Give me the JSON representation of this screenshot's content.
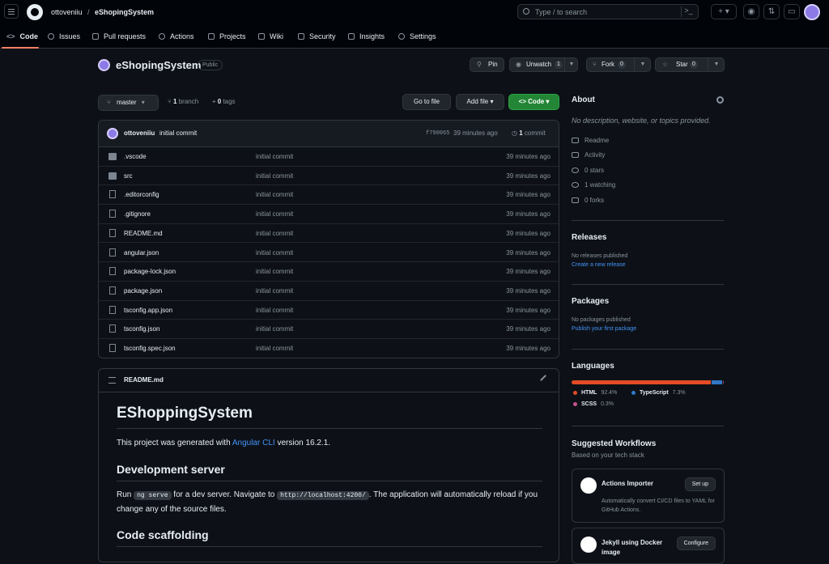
{
  "header": {
    "owner": "ottoveniiu",
    "separator": "/",
    "repo": "eShopingSystem",
    "search_placeholder": "Type / to search",
    "cmd_glyph": ">_"
  },
  "tabs": [
    "Code",
    "Issues",
    "Pull requests",
    "Actions",
    "Projects",
    "Wiki",
    "Security",
    "Insights",
    "Settings"
  ],
  "repo": {
    "name": "eShopingSystem",
    "visibility": "Public",
    "pin_label": "Pin",
    "watch_label": "Unwatch",
    "watch_count": "1",
    "fork_label": "Fork",
    "fork_count": "0",
    "star_label": "Star",
    "star_count": "0"
  },
  "branch_bar": {
    "branch": "master",
    "branches_count": "1",
    "branches_label": "branch",
    "tags_count": "0",
    "tags_label": "tags",
    "goto_file": "Go to file",
    "add_file": "Add file",
    "code_button": "Code"
  },
  "commit": {
    "user": "ottoveniiu",
    "message": "initial commit",
    "hash": "f790065",
    "time": "39 minutes ago",
    "count": "1",
    "count_label": "commit"
  },
  "files": [
    {
      "name": ".vscode",
      "type": "folder",
      "message": "initial commit",
      "time": "39 minutes ago"
    },
    {
      "name": "src",
      "type": "folder",
      "message": "initial commit",
      "time": "39 minutes ago"
    },
    {
      "name": ".editorconfig",
      "type": "file",
      "message": "initial commit",
      "time": "39 minutes ago"
    },
    {
      "name": ".gitignore",
      "type": "file",
      "message": "initial commit",
      "time": "39 minutes ago"
    },
    {
      "name": "README.md",
      "type": "file",
      "message": "initial commit",
      "time": "39 minutes ago"
    },
    {
      "name": "angular.json",
      "type": "file",
      "message": "initial commit",
      "time": "39 minutes ago"
    },
    {
      "name": "package-lock.json",
      "type": "file",
      "message": "initial commit",
      "time": "39 minutes ago"
    },
    {
      "name": "package.json",
      "type": "file",
      "message": "initial commit",
      "time": "39 minutes ago"
    },
    {
      "name": "tsconfig.app.json",
      "type": "file",
      "message": "initial commit",
      "time": "39 minutes ago"
    },
    {
      "name": "tsconfig.json",
      "type": "file",
      "message": "initial commit",
      "time": "39 minutes ago"
    },
    {
      "name": "tsconfig.spec.json",
      "type": "file",
      "message": "initial commit",
      "time": "39 minutes ago"
    }
  ],
  "readme": {
    "filename": "README.md",
    "h1": "EShoppingSystem",
    "intro_before": "This project was generated with ",
    "intro_link": "Angular CLI",
    "intro_after": " version 16.2.1.",
    "dev_heading": "Development server",
    "dev_run": "Run ",
    "dev_code1": "ng serve",
    "dev_mid": " for a dev server. Navigate to ",
    "dev_code2": "http://localhost:4200/",
    "dev_end": ". The application will automatically reload if you change any of the source files.",
    "scaffold_heading": "Code scaffolding"
  },
  "about": {
    "title": "About",
    "description": "No description, website, or topics provided.",
    "items": [
      "Readme",
      "Activity",
      "0 stars",
      "1 watching",
      "0 forks"
    ]
  },
  "releases": {
    "title": "Releases",
    "none": "No releases published",
    "link": "Create a new release"
  },
  "packages": {
    "title": "Packages",
    "none": "No packages published",
    "link": "Publish your first package"
  },
  "languages": {
    "title": "Languages",
    "items": [
      {
        "name": "HTML",
        "percent": "92.4%",
        "value": 92.4,
        "color": "#e34c26"
      },
      {
        "name": "TypeScript",
        "percent": "7.3%",
        "value": 7.3,
        "color": "#3178c6"
      },
      {
        "name": "SCSS",
        "percent": "0.3%",
        "value": 0.3,
        "color": "#c6538c"
      }
    ]
  },
  "workflows": {
    "title": "Suggested Workflows",
    "subtitle": "Based on your tech stack",
    "items": [
      {
        "title": "Actions Importer",
        "button": "Set up",
        "description": "Automatically convert CI/CD files to YAML for GitHub Actions."
      },
      {
        "title": "Jekyll using Docker image",
        "button": "Configure",
        "description": ""
      }
    ]
  }
}
